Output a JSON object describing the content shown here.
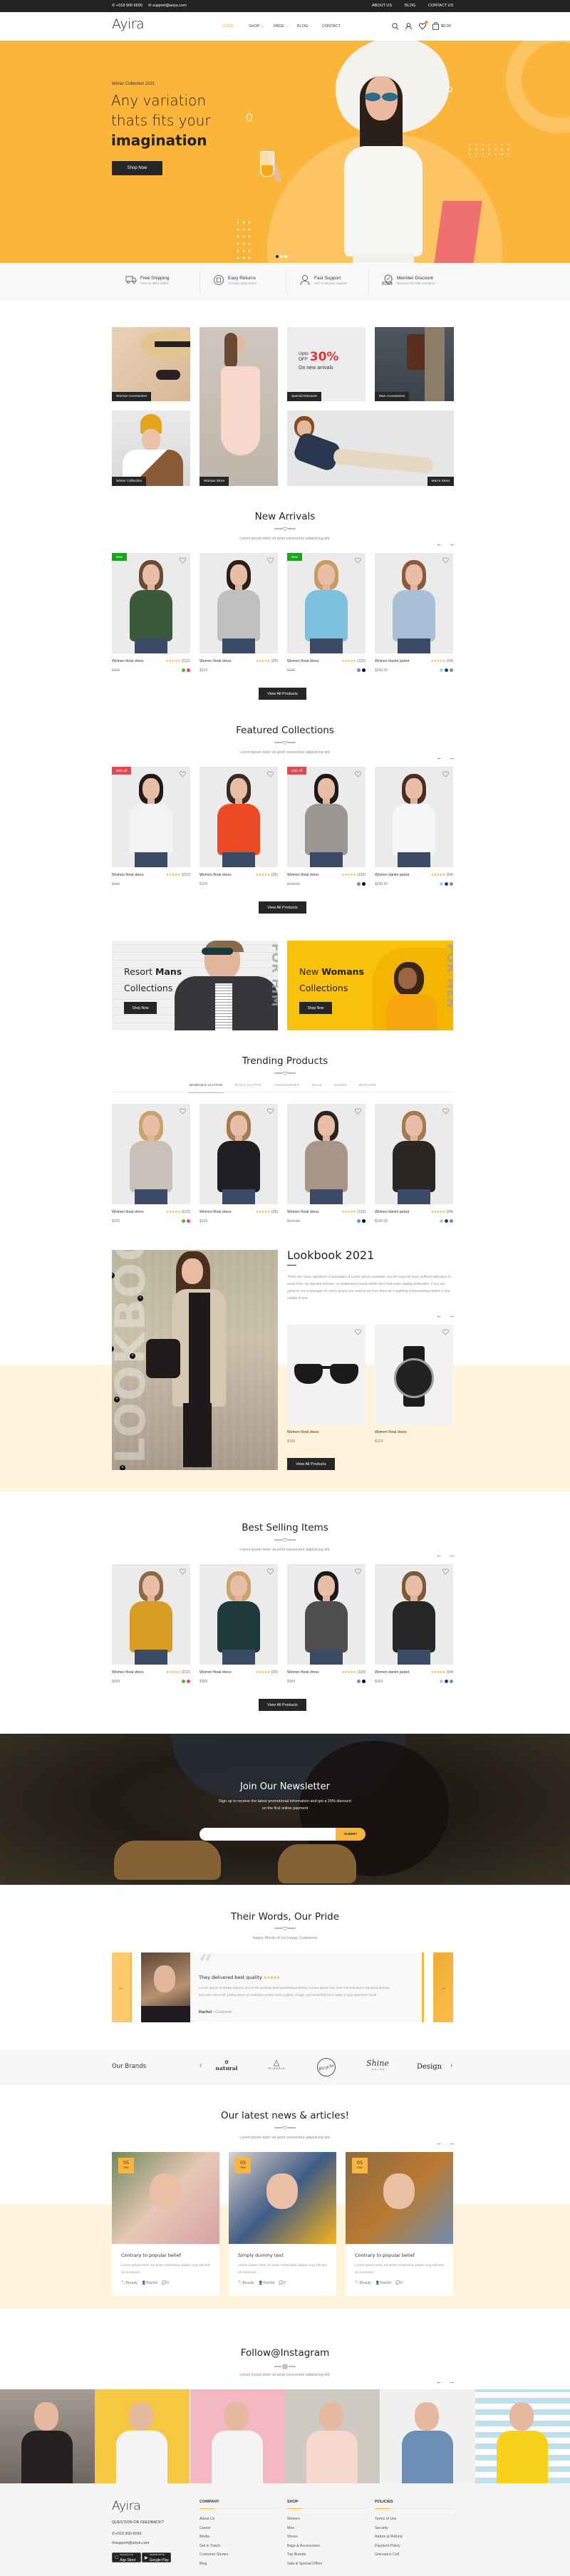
{
  "topbar": {
    "phone": "+018 900 6690",
    "email": "support@ariya.com",
    "links": [
      "ABOUT US",
      "BLOG",
      "CONTACT US"
    ]
  },
  "header": {
    "logo": "Ayira",
    "nav": [
      {
        "label": "HOME",
        "active": true,
        "dropdown": true
      },
      {
        "label": "SHOP",
        "active": false,
        "dropdown": true
      },
      {
        "label": "PAGE",
        "active": false,
        "dropdown": true
      },
      {
        "label": "BLOG",
        "active": false,
        "dropdown": false
      },
      {
        "label": "CONTACT",
        "active": false,
        "dropdown": false
      }
    ],
    "icons": [
      "search-icon",
      "user-icon",
      "heart-icon",
      "shopping-bag-icon"
    ],
    "wishlist_count": "0",
    "cart_total": "$0.00"
  },
  "hero": {
    "eyebrow": "Winter Collection 2021",
    "line1": "Any variation",
    "line2": "thats fits your",
    "line3": "imagination",
    "button": "Shop Now",
    "slide_count": 3,
    "active_slide": 1
  },
  "features": [
    {
      "icon": "truck-icon",
      "title": "Free Shipping",
      "subtitle": "Free for $50+orders"
    },
    {
      "icon": "return-icon",
      "title": "Easy Returns",
      "subtitle": "14 Days easy return"
    },
    {
      "icon": "headset-icon",
      "title": "Fast Support",
      "subtitle": "24/7 Customer support"
    },
    {
      "icon": "discount-icon",
      "title": "Member Discount",
      "subtitle": "Discount for elite members"
    }
  ],
  "categories": {
    "tiles": [
      "Woman Accessories",
      "Woman Store",
      "Special Discount",
      "Man Accessories",
      "Winter Collection",
      "Man's Store"
    ],
    "promo": {
      "upto": "Upto",
      "off": "OFF",
      "percent": "30%",
      "caption": "On new arrivals"
    }
  },
  "colors": {
    "accent": "#fbb53b",
    "dark": "#262626",
    "new_badge": "#19a51a",
    "sale_badge": "#e04a55",
    "cream": "#fff3dc"
  },
  "new_arrivals": {
    "title": "New Arrivals",
    "subtitle": "Lorem ipsum dolor sit amet consecetur adipisicing elit.",
    "button": "View All Products",
    "products": [
      {
        "name": "Women floral dress",
        "rating": 5,
        "count": "(212)",
        "price": "$235",
        "old": true,
        "badge": "New",
        "badge_type": "new",
        "colors": [
          "#5cb32a",
          "#e8457a"
        ]
      },
      {
        "name": "Women floral dress",
        "rating": 5,
        "count": "(25)",
        "price": "$129",
        "old": false,
        "colors": []
      },
      {
        "name": "Women floral dress",
        "rating": 5,
        "count": "(110)",
        "price": "$235",
        "old": true,
        "badge": "New",
        "badge_type": "new",
        "colors": [
          "#6f8fce",
          "#000000"
        ]
      },
      {
        "name": "Women danim jacket",
        "rating": 5,
        "count": "(04)",
        "price": "$249.00",
        "old": false,
        "colors": [
          "#a9d8c0",
          "#2b3a7a",
          "#6f8fce"
        ]
      }
    ]
  },
  "featured": {
    "title": "Featured Collections",
    "subtitle": "Lorem ipsum dolor sit amet consecetur adipisicing elit.",
    "button": "View All Products",
    "products": [
      {
        "name": "Women floral dress",
        "rating": 5,
        "count": "(212)",
        "price": "$235",
        "old": true,
        "badge": "20% off",
        "badge_type": "sale",
        "colors": []
      },
      {
        "name": "Women floral dress",
        "rating": 5,
        "count": "(25)",
        "price": "$129",
        "old": false,
        "colors": []
      },
      {
        "name": "Women floral dress",
        "rating": 5,
        "count": "(110)",
        "price": "$149.00",
        "old": true,
        "badge": "20% off",
        "badge_type": "sale",
        "colors": [
          "#6f8fce",
          "#000000"
        ]
      },
      {
        "name": "Women danim jacket",
        "rating": 5,
        "count": "(04)",
        "price": "$249.00",
        "old": false,
        "colors": [
          "#a9d8c0",
          "#2b3a7a",
          "#6f8fce"
        ]
      }
    ]
  },
  "banners": [
    {
      "light": "Resort ",
      "bold": "Mans",
      "line2": "Collections",
      "button": "Shop Now",
      "vertical": "FOR HIM"
    },
    {
      "light": "New ",
      "bold": "Womans",
      "line2": "Collections",
      "button": "Shop Now",
      "vertical": "FOR HER"
    }
  ],
  "trending": {
    "title": "Trending Products",
    "tabs": [
      {
        "label": "WOMAN'S CLOTHS",
        "active": true
      },
      {
        "label": "MAN'S CLOTHS",
        "active": false
      },
      {
        "label": "ASSESSORIES",
        "active": false
      },
      {
        "label": "BAGS",
        "active": false
      },
      {
        "label": "SHOES",
        "active": false
      },
      {
        "label": "WATCHES",
        "active": false
      }
    ],
    "products": [
      {
        "name": "Women floral dress",
        "rating": 5,
        "count": "(212)",
        "price": "$235",
        "old": false,
        "colors": [
          "#5cb32a",
          "#e8457a"
        ]
      },
      {
        "name": "Women floral dress",
        "rating": 5,
        "count": "(25)",
        "price": "$129",
        "old": false,
        "colors": []
      },
      {
        "name": "Women floral dress",
        "rating": 5,
        "count": "(110)",
        "price": "$149.00",
        "old": true,
        "colors": [
          "#6f8fce",
          "#000000"
        ]
      },
      {
        "name": "Women danim jacket",
        "rating": 5,
        "count": "(04)",
        "price": "$249.00",
        "old": false,
        "colors": [
          "#a9d8c0",
          "#2b3a7a",
          "#6f8fce"
        ]
      }
    ]
  },
  "lookbook": {
    "title": "Lookbook 2021",
    "watermark": "LOOKBOOK",
    "text": "There are many variations of passages of Lorem Ipsum available, but the majority have suffered alteration in some form, by injected humour, or randomised words which don't look even slightly believable. If you are going to use a passage of Lorem Ipsum,you need to be sure there isn't anything embarrassing hidden in the middle of text.",
    "products": [
      {
        "name": "Women floral dress",
        "price": "$150"
      },
      {
        "name": "Women floral dress",
        "price": "$129"
      }
    ],
    "button": "View All Products"
  },
  "best_selling": {
    "title": "Best Selling Items",
    "subtitle": "Lorem ipsum dolor sit amet consecetur adipisicing elit.",
    "button": "View All Products",
    "products": [
      {
        "name": "Women floral dress",
        "rating": 5,
        "count": "(212)",
        "price": "$399",
        "old": false,
        "colors": [
          "#5cb32a",
          "#e8457a"
        ]
      },
      {
        "name": "Women floral dress",
        "rating": 5,
        "count": "(25)",
        "price": "$399",
        "old": false,
        "colors": []
      },
      {
        "name": "Women floral dress",
        "rating": 5,
        "count": "(110)",
        "price": "$399",
        "old": false,
        "colors": [
          "#6f8fce",
          "#000000"
        ]
      },
      {
        "name": "Women danim jacket",
        "rating": 5,
        "count": "(04)",
        "price": "$399",
        "old": false,
        "colors": [
          "#a9d8c0",
          "#2b3a7a",
          "#6f8fce"
        ]
      }
    ]
  },
  "newsletter": {
    "title": "Join Our Newsletter",
    "text1": "Sign up to receive the latest promotional information and get a 20% discount",
    "text2": "on the first online payment",
    "placeholder": "",
    "button": "SUBMIT"
  },
  "testimonials": {
    "title": "Their Words, Our Pride",
    "subtitle": "Happy Words of our Happy Customers",
    "heading": "They delivered best quality",
    "rating": 5,
    "text": "Lorem Ipsum is simply dummy text of the printing and typesetting industry. Lorem Ipsum has been the industry's standard dummy text ever since the 1500s,when an unknown printer took a galley of type and scrambled it to make a type specimen book.",
    "name": "Rachel",
    "role": "Customer"
  },
  "brands": {
    "label": "Our Brands",
    "items": [
      {
        "name": "natural"
      },
      {
        "name": "TRIANGLE"
      },
      {
        "name": "Bicycle"
      },
      {
        "name": "Shine",
        "tag": "TAGLINE"
      },
      {
        "name": "Design"
      }
    ]
  },
  "news": {
    "title": "Our latest news & articles!",
    "subtitle": "Lorem ipsum dolor sit amet consecetur adipisicing elit.",
    "posts": [
      {
        "day": "05",
        "month": "nov",
        "title": "Contrary to popular belief",
        "excerpt": "Lorem ipsum dolor sit amet consecetur adipisi cing elit,sed do eiusmod...",
        "tag": "Beauty",
        "author": "Rachel",
        "comments": "0"
      },
      {
        "day": "05",
        "month": "nov",
        "title": "Simply dummy text",
        "excerpt": "Lorem ipsum dolor sit amet consecetur adipisi cing elit,sed do eiusmod...",
        "tag": "Beauty",
        "author": "Rachel",
        "comments": "0"
      },
      {
        "day": "05",
        "month": "nov",
        "title": "Contrary to popular belief",
        "excerpt": "Lorem ipsum dolor sit amet consecetur adipisi cing elit,sed do eiusmod...",
        "tag": "Beauty",
        "author": "Rachel",
        "comments": "0"
      }
    ]
  },
  "instagram": {
    "title": "Follow@Instagram",
    "subtitle": "Lorem ipsum dolor sit amet consecetur adipisicing elit."
  },
  "footer": {
    "logo": "Ayira",
    "question": "QUESTION OR FEEDBACK?",
    "phone": "+018 900 6690",
    "email": "support@ariya.com",
    "app_store": {
      "small": "Download on the",
      "big": "App Store"
    },
    "google_play": {
      "small": "ANDROID APP ON",
      "big": "Google Play"
    },
    "columns": [
      {
        "title": "COMPANY",
        "links": [
          "About Us",
          "Career",
          "Media",
          "Get in Touch",
          "Customer Stories",
          "Blog"
        ]
      },
      {
        "title": "SHOP",
        "links": [
          "Women",
          "Men",
          "Shoes",
          "Bags & Accessories",
          "Top Brands",
          "Sale & Special Offers"
        ]
      },
      {
        "title": "POLICIES",
        "links": [
          "Terms of Use",
          "Security",
          "Return & Refund",
          "Payment Policy",
          "Grievance Cell"
        ]
      }
    ]
  }
}
